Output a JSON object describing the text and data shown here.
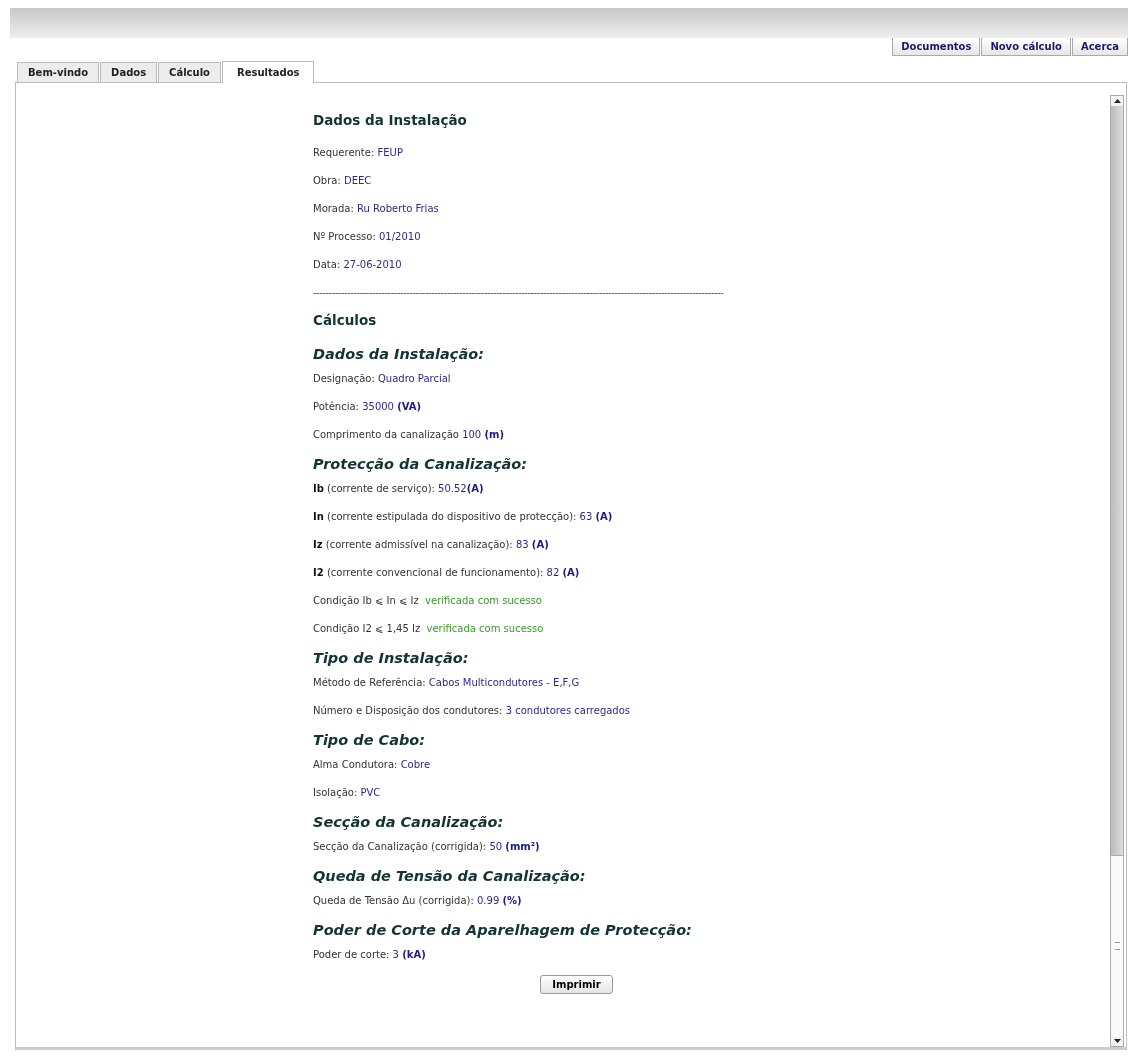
{
  "top_buttons": [
    "Documentos",
    "Novo cálculo",
    "Acerca"
  ],
  "tabs": [
    {
      "label": "Bem-vindo",
      "selected": false
    },
    {
      "label": "Dados",
      "selected": false
    },
    {
      "label": "Cálculo",
      "selected": false
    },
    {
      "label": "Resultados",
      "selected": true
    }
  ],
  "results": [
    {
      "kind": "heading",
      "text": "Dados da Instalação"
    },
    {
      "kind": "field",
      "label": "Requerente:",
      "value": "FEUP"
    },
    {
      "kind": "field",
      "label": "Obra:",
      "value": "DEEC"
    },
    {
      "kind": "field",
      "label": "Morada:",
      "value": "Ru Roberto Frias"
    },
    {
      "kind": "field",
      "label": "Nº Processo:",
      "value": "01/2010"
    },
    {
      "kind": "field",
      "label": "Data:",
      "value": "27-06-2010"
    },
    {
      "kind": "rule",
      "text": "------------------------------------------------------------------------------------------------------------------------------------"
    },
    {
      "kind": "heading",
      "text": "Cálculos"
    },
    {
      "kind": "section",
      "text": "Dados da Instalação:"
    },
    {
      "kind": "field",
      "label": "Designação:",
      "value": "Quadro Parcial"
    },
    {
      "kind": "field",
      "label": "Potência:",
      "value": "35000",
      "unit": "(VA)"
    },
    {
      "kind": "field",
      "label": "Comprimento da canalização",
      "value": "100",
      "unit": "(m)"
    },
    {
      "kind": "section",
      "text": "Protecção da Canalização:"
    },
    {
      "kind": "field",
      "term": "Ib",
      "label": "(corrente de serviço):",
      "value": "50.52",
      "unit": "(A)",
      "tight": true
    },
    {
      "kind": "field",
      "term": "In",
      "label": "(corrente estipulada do dispositivo de protecção):",
      "value": "63",
      "unit": "(A)"
    },
    {
      "kind": "field",
      "term": "Iz",
      "label": "(corrente admissível na canalização):",
      "value": "83",
      "unit": "(A)"
    },
    {
      "kind": "field",
      "term": "I2",
      "label": "(corrente convencional de funcionamento):",
      "value": "82",
      "unit": "(A)"
    },
    {
      "kind": "check",
      "label": "Condição Ib ⩽ In ⩽ Iz",
      "status": "verificada com sucesso"
    },
    {
      "kind": "check",
      "label": "Condição I2 ⩽ 1,45 Iz",
      "status": "verificada com sucesso"
    },
    {
      "kind": "section",
      "text": "Tipo de Instalação:"
    },
    {
      "kind": "field",
      "label": "Método de Referência:",
      "value": "Cabos Multicondutores - E,F,G"
    },
    {
      "kind": "field",
      "label": "Número e Disposição dos condutores:",
      "value": "3 condutores carregados"
    },
    {
      "kind": "section",
      "text": "Tipo de Cabo:"
    },
    {
      "kind": "field",
      "label": "Alma Condutora:",
      "value": "Cobre"
    },
    {
      "kind": "field",
      "label": "Isolação:",
      "value": "PVC"
    },
    {
      "kind": "section",
      "text": "Secção da Canalização:"
    },
    {
      "kind": "field",
      "label": "Secção da Canalização (corrigida):",
      "value": "50",
      "unit": "(mm²)"
    },
    {
      "kind": "section",
      "text": "Queda de Tensão da Canalização:"
    },
    {
      "kind": "field",
      "label": "Queda de Tensão Δu (corrigida):",
      "value": "0.99",
      "unit": "(%)"
    },
    {
      "kind": "section",
      "text": "Poder de Corte da Aparelhagem de Protecção:"
    },
    {
      "kind": "field",
      "label": "Poder de corte:",
      "value": "3",
      "unit": "(kA)"
    }
  ],
  "print_button": "Imprimir"
}
